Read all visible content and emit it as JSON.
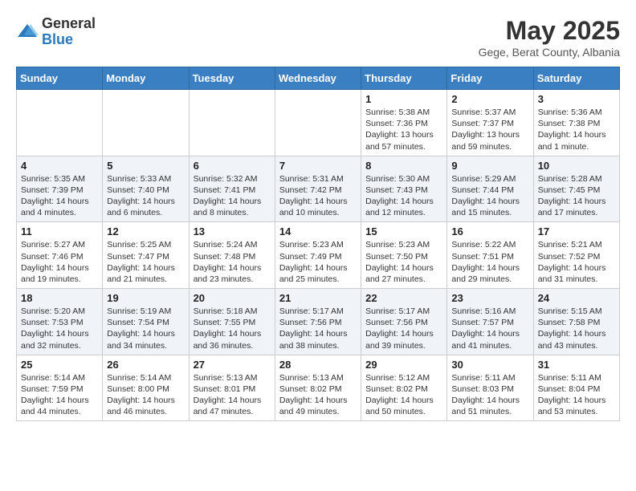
{
  "header": {
    "logo_general": "General",
    "logo_blue": "Blue",
    "month_year": "May 2025",
    "location": "Gege, Berat County, Albania"
  },
  "days_of_week": [
    "Sunday",
    "Monday",
    "Tuesday",
    "Wednesday",
    "Thursday",
    "Friday",
    "Saturday"
  ],
  "weeks": [
    [
      {
        "day": "",
        "info": ""
      },
      {
        "day": "",
        "info": ""
      },
      {
        "day": "",
        "info": ""
      },
      {
        "day": "",
        "info": ""
      },
      {
        "day": "1",
        "info": "Sunrise: 5:38 AM\nSunset: 7:36 PM\nDaylight: 13 hours and 57 minutes."
      },
      {
        "day": "2",
        "info": "Sunrise: 5:37 AM\nSunset: 7:37 PM\nDaylight: 13 hours and 59 minutes."
      },
      {
        "day": "3",
        "info": "Sunrise: 5:36 AM\nSunset: 7:38 PM\nDaylight: 14 hours and 1 minute."
      }
    ],
    [
      {
        "day": "4",
        "info": "Sunrise: 5:35 AM\nSunset: 7:39 PM\nDaylight: 14 hours and 4 minutes."
      },
      {
        "day": "5",
        "info": "Sunrise: 5:33 AM\nSunset: 7:40 PM\nDaylight: 14 hours and 6 minutes."
      },
      {
        "day": "6",
        "info": "Sunrise: 5:32 AM\nSunset: 7:41 PM\nDaylight: 14 hours and 8 minutes."
      },
      {
        "day": "7",
        "info": "Sunrise: 5:31 AM\nSunset: 7:42 PM\nDaylight: 14 hours and 10 minutes."
      },
      {
        "day": "8",
        "info": "Sunrise: 5:30 AM\nSunset: 7:43 PM\nDaylight: 14 hours and 12 minutes."
      },
      {
        "day": "9",
        "info": "Sunrise: 5:29 AM\nSunset: 7:44 PM\nDaylight: 14 hours and 15 minutes."
      },
      {
        "day": "10",
        "info": "Sunrise: 5:28 AM\nSunset: 7:45 PM\nDaylight: 14 hours and 17 minutes."
      }
    ],
    [
      {
        "day": "11",
        "info": "Sunrise: 5:27 AM\nSunset: 7:46 PM\nDaylight: 14 hours and 19 minutes."
      },
      {
        "day": "12",
        "info": "Sunrise: 5:25 AM\nSunset: 7:47 PM\nDaylight: 14 hours and 21 minutes."
      },
      {
        "day": "13",
        "info": "Sunrise: 5:24 AM\nSunset: 7:48 PM\nDaylight: 14 hours and 23 minutes."
      },
      {
        "day": "14",
        "info": "Sunrise: 5:23 AM\nSunset: 7:49 PM\nDaylight: 14 hours and 25 minutes."
      },
      {
        "day": "15",
        "info": "Sunrise: 5:23 AM\nSunset: 7:50 PM\nDaylight: 14 hours and 27 minutes."
      },
      {
        "day": "16",
        "info": "Sunrise: 5:22 AM\nSunset: 7:51 PM\nDaylight: 14 hours and 29 minutes."
      },
      {
        "day": "17",
        "info": "Sunrise: 5:21 AM\nSunset: 7:52 PM\nDaylight: 14 hours and 31 minutes."
      }
    ],
    [
      {
        "day": "18",
        "info": "Sunrise: 5:20 AM\nSunset: 7:53 PM\nDaylight: 14 hours and 32 minutes."
      },
      {
        "day": "19",
        "info": "Sunrise: 5:19 AM\nSunset: 7:54 PM\nDaylight: 14 hours and 34 minutes."
      },
      {
        "day": "20",
        "info": "Sunrise: 5:18 AM\nSunset: 7:55 PM\nDaylight: 14 hours and 36 minutes."
      },
      {
        "day": "21",
        "info": "Sunrise: 5:17 AM\nSunset: 7:56 PM\nDaylight: 14 hours and 38 minutes."
      },
      {
        "day": "22",
        "info": "Sunrise: 5:17 AM\nSunset: 7:56 PM\nDaylight: 14 hours and 39 minutes."
      },
      {
        "day": "23",
        "info": "Sunrise: 5:16 AM\nSunset: 7:57 PM\nDaylight: 14 hours and 41 minutes."
      },
      {
        "day": "24",
        "info": "Sunrise: 5:15 AM\nSunset: 7:58 PM\nDaylight: 14 hours and 43 minutes."
      }
    ],
    [
      {
        "day": "25",
        "info": "Sunrise: 5:14 AM\nSunset: 7:59 PM\nDaylight: 14 hours and 44 minutes."
      },
      {
        "day": "26",
        "info": "Sunrise: 5:14 AM\nSunset: 8:00 PM\nDaylight: 14 hours and 46 minutes."
      },
      {
        "day": "27",
        "info": "Sunrise: 5:13 AM\nSunset: 8:01 PM\nDaylight: 14 hours and 47 minutes."
      },
      {
        "day": "28",
        "info": "Sunrise: 5:13 AM\nSunset: 8:02 PM\nDaylight: 14 hours and 49 minutes."
      },
      {
        "day": "29",
        "info": "Sunrise: 5:12 AM\nSunset: 8:02 PM\nDaylight: 14 hours and 50 minutes."
      },
      {
        "day": "30",
        "info": "Sunrise: 5:11 AM\nSunset: 8:03 PM\nDaylight: 14 hours and 51 minutes."
      },
      {
        "day": "31",
        "info": "Sunrise: 5:11 AM\nSunset: 8:04 PM\nDaylight: 14 hours and 53 minutes."
      }
    ]
  ]
}
